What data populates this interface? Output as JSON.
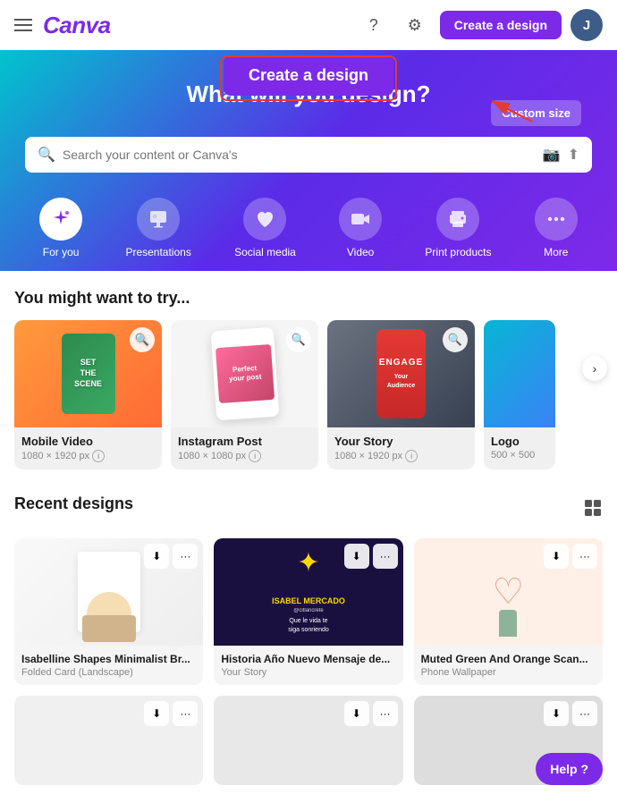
{
  "header": {
    "logo": "Canva",
    "help_label": "?",
    "settings_label": "⚙",
    "create_btn": "Create a design",
    "avatar_letter": "J"
  },
  "popup": {
    "label": "Create a design"
  },
  "hero": {
    "title": "What will you design?",
    "custom_size": "Custom size",
    "search_placeholder": "Search your content or Canva's"
  },
  "categories": [
    {
      "id": "for-you",
      "label": "For you",
      "icon": "✦"
    },
    {
      "id": "presentations",
      "label": "Presentations",
      "icon": "🖥"
    },
    {
      "id": "social-media",
      "label": "Social media",
      "icon": "♥"
    },
    {
      "id": "video",
      "label": "Video",
      "icon": "▶"
    },
    {
      "id": "print-products",
      "label": "Print products",
      "icon": "🖨"
    },
    {
      "id": "more",
      "label": "More",
      "icon": "···"
    }
  ],
  "try_section": {
    "title": "You might want to try...",
    "cards": [
      {
        "name": "Mobile Video",
        "dim": "1080 × 1920 px"
      },
      {
        "name": "Instagram Post",
        "dim": "1080 × 1080 px"
      },
      {
        "name": "Your Story",
        "dim": "1080 × 1920 px"
      },
      {
        "name": "Logo",
        "dim": "500 × 500"
      }
    ]
  },
  "recent_section": {
    "title": "Recent designs",
    "designs": [
      {
        "name": "Isabelline Shapes Minimalist Br...",
        "type": "Folded Card (Landscape)"
      },
      {
        "name": "Historia Año Nuevo Mensaje de...",
        "type": "Your Story"
      },
      {
        "name": "Muted Green And Orange Scan...",
        "type": "Phone Wallpaper"
      }
    ]
  },
  "help_btn": "Help  ?"
}
